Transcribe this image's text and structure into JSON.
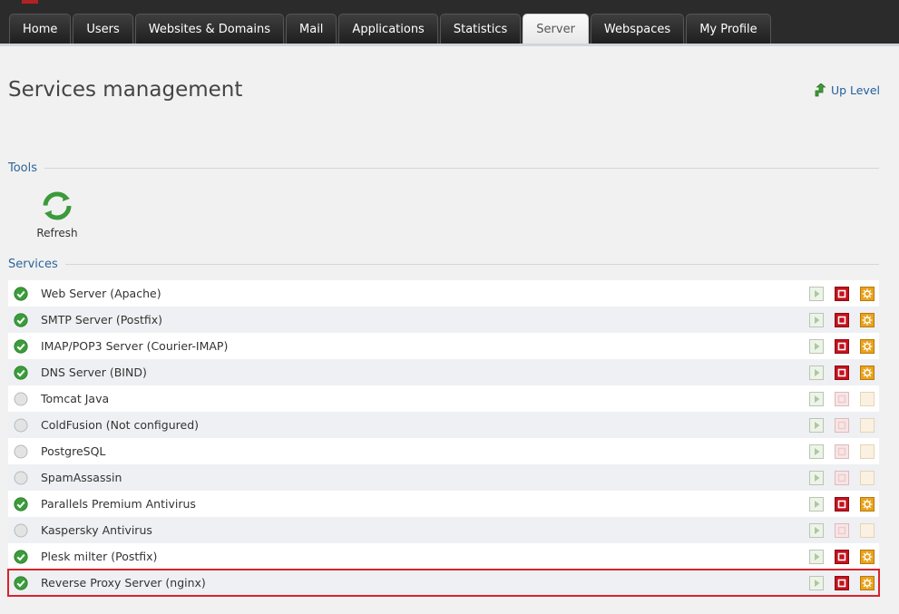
{
  "nav": {
    "tabs": [
      {
        "label": "Home",
        "active": false
      },
      {
        "label": "Users",
        "active": false
      },
      {
        "label": "Websites & Domains",
        "active": false
      },
      {
        "label": "Mail",
        "active": false
      },
      {
        "label": "Applications",
        "active": false
      },
      {
        "label": "Statistics",
        "active": false
      },
      {
        "label": "Server",
        "active": true
      },
      {
        "label": "Webspaces",
        "active": false
      },
      {
        "label": "My Profile",
        "active": false
      }
    ]
  },
  "page": {
    "title": "Services management",
    "up_level_label": "Up Level"
  },
  "tools": {
    "heading": "Tools",
    "refresh_label": "Refresh",
    "refresh_icon": "refresh-icon"
  },
  "services": {
    "heading": "Services",
    "items": [
      {
        "name": "Web Server (Apache)",
        "running": true
      },
      {
        "name": "SMTP Server (Postfix)",
        "running": true
      },
      {
        "name": "IMAP/POP3 Server (Courier-IMAP)",
        "running": true
      },
      {
        "name": "DNS Server (BIND)",
        "running": true
      },
      {
        "name": "Tomcat Java",
        "running": false
      },
      {
        "name": "ColdFusion (Not configured)",
        "running": false
      },
      {
        "name": "PostgreSQL",
        "running": false
      },
      {
        "name": "SpamAssassin",
        "running": false
      },
      {
        "name": "Parallels Premium Antivirus",
        "running": true
      },
      {
        "name": "Kaspersky Antivirus",
        "running": false
      },
      {
        "name": "Plesk milter (Postfix)",
        "running": true
      },
      {
        "name": "Reverse Proxy Server (nginx)",
        "running": true,
        "highlighted": true
      }
    ]
  },
  "colors": {
    "nav_bg": "#2b2b2b",
    "link": "#1f5f9f",
    "section_heading": "#2c6599",
    "running_green": "#3a9d3a",
    "stop_red": "#c4121d",
    "restart_orange": "#e9a21c",
    "highlight_border": "#d9232d"
  }
}
